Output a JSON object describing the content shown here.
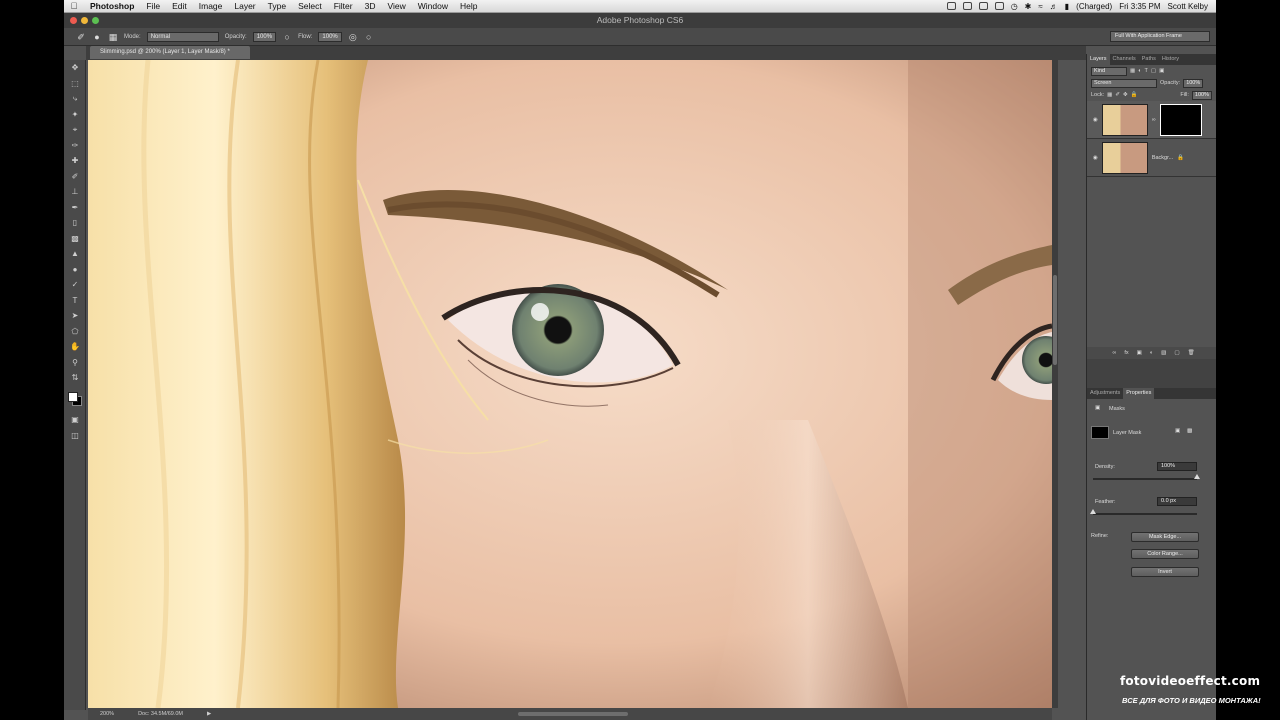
{
  "menubar": {
    "app_name": "Photoshop",
    "items": [
      "File",
      "Edit",
      "Image",
      "Layer",
      "Type",
      "Select",
      "Filter",
      "3D",
      "View",
      "Window",
      "Help"
    ],
    "battery": "(Charged)",
    "clock": "Fri 3:35 PM",
    "user": "Scott Kelby"
  },
  "window": {
    "title": "Adobe Photoshop CS6"
  },
  "options": {
    "mode_label": "Mode:",
    "mode_value": "Normal",
    "opacity_label": "Opacity:",
    "opacity_value": "100%",
    "flow_label": "Flow:",
    "flow_value": "100%",
    "workspace": "Full With Application Frame"
  },
  "document": {
    "tab_title": "Slimming.psd @ 200% (Layer 1, Layer Mask/8) *",
    "zoom": "200%",
    "doc_size": "Doc: 34.5M/69.0M"
  },
  "layers_panel": {
    "tabs": [
      "Layers",
      "Channels",
      "Paths",
      "History"
    ],
    "filter": "Kind",
    "blend_mode": "Screen",
    "opacity_label": "Opacity:",
    "opacity_value": "100%",
    "lock_label": "Lock:",
    "fill_label": "Fill:",
    "fill_value": "100%",
    "layers": [
      {
        "name": ""
      },
      {
        "name": "Backgr..."
      }
    ]
  },
  "properties_panel": {
    "tabs": [
      "Adjustments",
      "Properties"
    ],
    "section": "Masks",
    "mask_label": "Layer Mask",
    "density_label": "Density:",
    "density_value": "100%",
    "density_level": 1.0,
    "feather_label": "Feather:",
    "feather_value": "0.0 px",
    "feather_level": 0.0,
    "refine_label": "Refine:",
    "mask_edge_button": "Mask Edge...",
    "color_range_button": "Color Range...",
    "invert_button": "Invert"
  },
  "watermark": {
    "site": "fotovideoeffect.com",
    "tagline": "ВСЕ ДЛЯ ФОТО И ВИДЕО МОНТАЖА!"
  }
}
